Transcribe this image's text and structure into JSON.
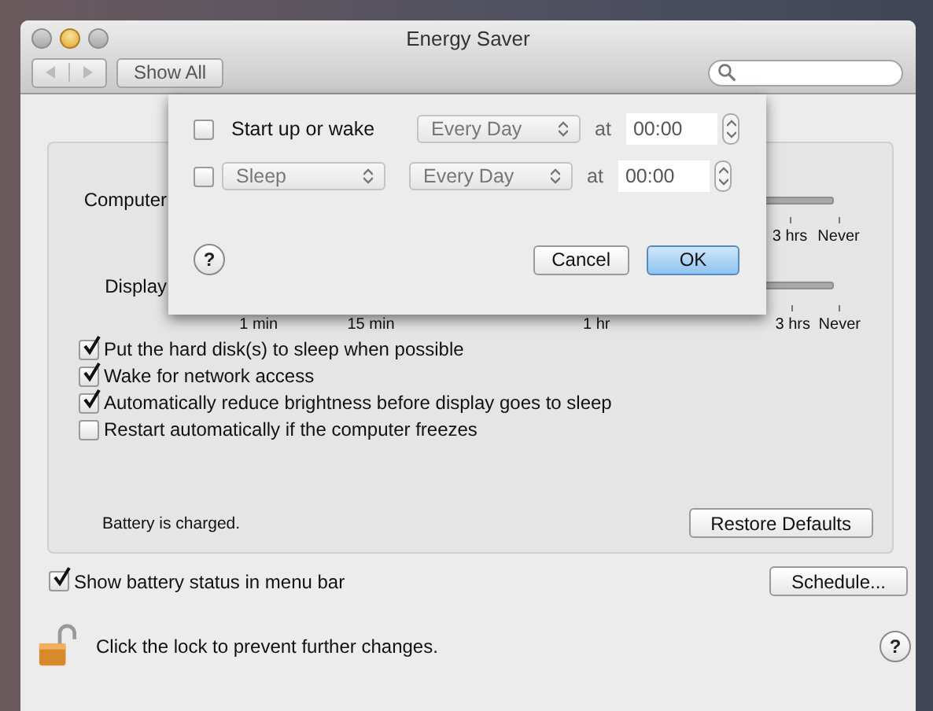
{
  "window": {
    "title": "Energy Saver"
  },
  "toolbar": {
    "show_all": "Show All"
  },
  "sliders": [
    {
      "label": "Computer",
      "ticks": [
        "3 hrs",
        "Never"
      ]
    },
    {
      "label": "Display",
      "ticks": [
        "1 min",
        "15 min",
        "1 hr",
        "3 hrs",
        "Never"
      ]
    }
  ],
  "options": [
    {
      "label": "Put the hard disk(s) to sleep when possible",
      "checked": true
    },
    {
      "label": "Wake for network access",
      "checked": true
    },
    {
      "label": "Automatically reduce brightness before display goes to sleep",
      "checked": true
    },
    {
      "label": "Restart automatically if the computer freezes",
      "checked": false
    }
  ],
  "battery_status": "Battery is charged.",
  "restore_button": "Restore Defaults",
  "menu_bar_option": {
    "label": "Show battery status in menu bar",
    "checked": true
  },
  "schedule_button": "Schedule...",
  "lock_text": "Click the lock to prevent further changes.",
  "help": "?",
  "sheet": {
    "rows": [
      {
        "kind": "label",
        "checked": false,
        "action": "Start up or wake",
        "repeat": "Every Day",
        "at": "at",
        "time": "00:00"
      },
      {
        "kind": "popup",
        "checked": false,
        "action": "Sleep",
        "repeat": "Every Day",
        "at": "at",
        "time": "00:00"
      }
    ],
    "help": "?",
    "cancel": "Cancel",
    "ok": "OK"
  }
}
